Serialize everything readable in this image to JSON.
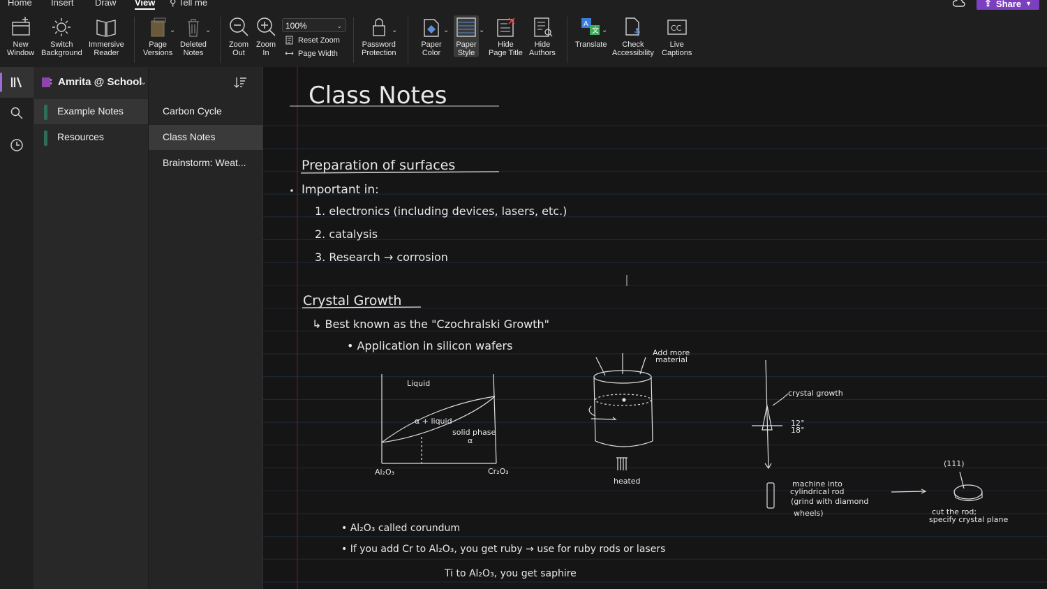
{
  "menu": {
    "tabs": [
      {
        "label": "Home"
      },
      {
        "label": "Insert"
      },
      {
        "label": "Draw"
      },
      {
        "label": "View"
      },
      {
        "label": "Tell me"
      }
    ],
    "share_label": "Share"
  },
  "ribbon": {
    "new_window": "New\nWindow",
    "switch_background": "Switch\nBackground",
    "immersive_reader": "Immersive\nReader",
    "page_versions": "Page\nVersions",
    "deleted_notes": "Deleted\nNotes",
    "zoom_out": "Zoom\nOut",
    "zoom_in": "Zoom\nIn",
    "zoom_value": "100%",
    "reset_zoom": "Reset Zoom",
    "page_width": "Page Width",
    "password_protection": "Password\nProtection",
    "paper_color": "Paper\nColor",
    "paper_style": "Paper\nStyle",
    "hide_page_title": "Hide\nPage Title",
    "hide_authors": "Hide\nAuthors",
    "translate": "Translate",
    "check_accessibility": "Check\nAccessibility",
    "live_captions": "Live\nCaptions"
  },
  "notebook": {
    "name": "Amrita @ School",
    "sections": [
      {
        "label": "Example Notes",
        "active": true
      },
      {
        "label": "Resources",
        "active": false
      }
    ],
    "pages": [
      {
        "label": "Carbon Cycle",
        "active": false
      },
      {
        "label": "Class Notes",
        "active": true
      },
      {
        "label": "Brainstorm: Weat...",
        "active": false
      }
    ]
  },
  "note": {
    "title": "Class Notes",
    "heading1": "Preparation of surfaces",
    "important": "Important in:",
    "item1": "1. electronics (including devices, lasers, etc.)",
    "item2": "2. catalysis",
    "item3": "3. Research → corrosion",
    "heading2": "Crystal Growth",
    "best_known": "↳ Best known as the \"Czochralski Growth\"",
    "application": "• Application in silicon wafers",
    "phase_diagram": {
      "liquid": "Liquid",
      "a_liquid": "α + liquid",
      "solid_phase": "solid phase",
      "alpha": "α",
      "left_axis": "Al₂O₃",
      "right_axis": "Cr₂O₃"
    },
    "crucible": {
      "add_more": "Add more",
      "material": "material",
      "heated": "heated"
    },
    "rod": {
      "crystal_growth": "crystal growth",
      "angle1": "12°",
      "angle2": "18°"
    },
    "machine_note": [
      "machine into",
      "cylindrical rod",
      "(grind with diamond",
      "wheels)"
    ],
    "cut_note": {
      "label": "(111)",
      "line1": "cut the rod;",
      "line2": "specify crystal plane"
    },
    "bullet1": "• Al₂O₃ called corundum",
    "bullet2": "• If you add Cr to Al₂O₃, you get ruby → use for ruby rods or lasers",
    "bullet3": "Ti to Al₂O₃, you get saphire"
  }
}
